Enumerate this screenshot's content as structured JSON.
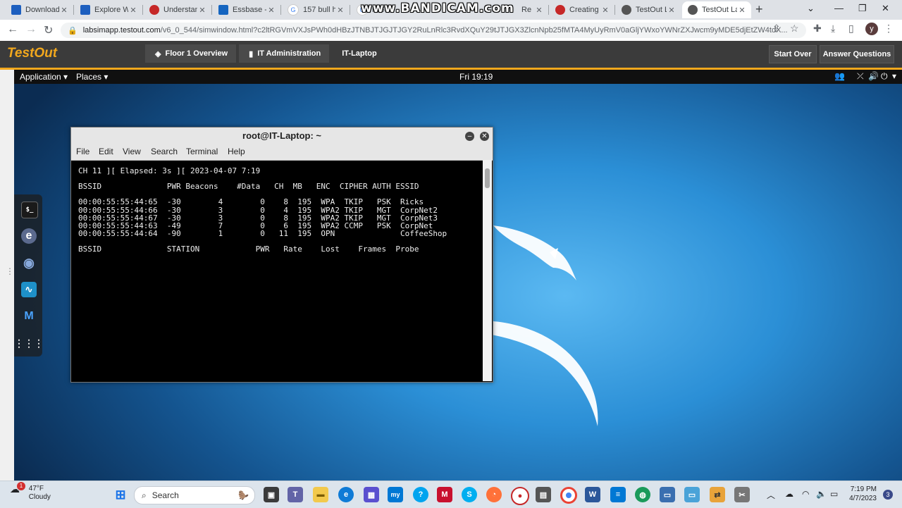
{
  "browser": {
    "tabs": [
      {
        "title": "Download",
        "color": "#1d5fbf"
      },
      {
        "title": "Explore Wi",
        "color": "#1d5fbf"
      },
      {
        "title": "Understan",
        "color": "#c62828"
      },
      {
        "title": "Essbase -",
        "color": "#1565c0"
      },
      {
        "title": "157 bull h",
        "color": "#4285f4"
      },
      {
        "title": "i 765",
        "color": "#4285f4"
      },
      {
        "title": "Re",
        "color": "#888888"
      },
      {
        "title": "Creating a",
        "color": "#c62828"
      },
      {
        "title": "TestOut La",
        "color": "#555555"
      },
      {
        "title": "TestOut La",
        "color": "#555555"
      }
    ],
    "new_tab": "+",
    "watermark": "www.BANDICAM.com",
    "url_host": "labsimapp.testout.com",
    "url_path": "/v6_0_544/simwindow.html?c2ltRGVmVXJsPWh0dHBzJTNBJTJGJTJGY2RuLnRlc3RvdXQuY29tJTJGX3ZlcnNpb25fMTA4MyUyRmV0aGljYWxoYWNrZXJwcm9yMDE5djEtZW4tdX...",
    "avatar_letter": "y"
  },
  "testout": {
    "logo": "TestOut",
    "breadcrumbs": [
      "Floor 1 Overview",
      "IT Administration",
      "IT-Laptop"
    ],
    "start_over": "Start Over",
    "answer_questions": "Answer Questions"
  },
  "gnome": {
    "application": "Application ▾",
    "places": "Places ▾",
    "clock": "Fri 19:19"
  },
  "terminal": {
    "title": "root@IT-Laptop: ~",
    "menu": [
      "File",
      "Edit",
      "View",
      "Search",
      "Terminal",
      "Help"
    ],
    "status_line": "CH 11 ][ Elapsed: 3s ][ 2023-04-07 7:19",
    "ap_header": "BSSID              PWR Beacons    #Data   CH  MB   ENC  CIPHER AUTH ESSID",
    "ap_rows": [
      "00:00:55:55:44:65  -30        4        0    8  195  WPA  TKIP   PSK  Ricks",
      "00:00:55:55:44:66  -30        3        0    4  195  WPA2 TKIP   MGT  CorpNet2",
      "00:00:55:55:44:67  -30        3        0    8  195  WPA2 TKIP   MGT  CorpNet3",
      "00:00:55:55:44:63  -49        7        0    6  195  WPA2 CCMP   PSK  CorpNet",
      "00:00:55:55:44:64  -90        1        0   11  195  OPN              CoffeeShop"
    ],
    "station_header": "BSSID              STATION            PWR   Rate    Lost    Frames  Probe"
  },
  "taskbar": {
    "weather_temp": "47°F",
    "weather_cond": "Cloudy",
    "weather_badge": "1",
    "search": "Search",
    "time": "7:19 PM",
    "date": "4/7/2023",
    "notifications": "3"
  }
}
